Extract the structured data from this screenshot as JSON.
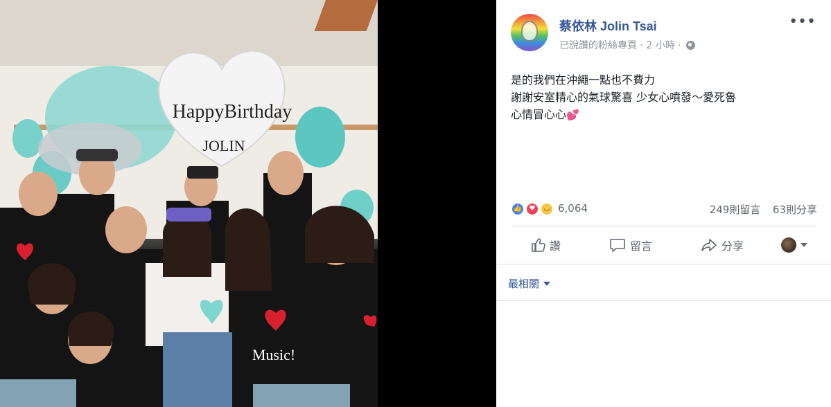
{
  "photo": {
    "balloon_heart_line1": "HappyBirthday",
    "balloon_heart_line2": "JOLIN",
    "tshirt_text": "Music!"
  },
  "post": {
    "page_name": "蔡依林 Jolin Tsai",
    "meta": "已說讚的粉絲專頁 · 2 小時 ·",
    "privacy_icon": "globe-icon",
    "more_label": "•••",
    "text_lines": [
      "是的我們在沖繩一點也不費力",
      "謝謝安室精心的氣球驚喜 少女心噴發～愛死魯",
      "心情冒心心"
    ],
    "text_emoji": "💕"
  },
  "stats": {
    "reactions": [
      "like-icon",
      "love-icon",
      "haha-icon"
    ],
    "reaction_count": "6,064",
    "comments": "249則留言",
    "shares": "63則分享"
  },
  "actions": {
    "like": "讚",
    "comment": "留言",
    "share": "分享"
  },
  "comments": {
    "sort_label": "最相關"
  },
  "colors": {
    "link": "#365899",
    "meta": "#90949c",
    "text": "#1d2129",
    "like": "#4a81f0",
    "love": "#f0405a",
    "haha": "#f7c742"
  }
}
